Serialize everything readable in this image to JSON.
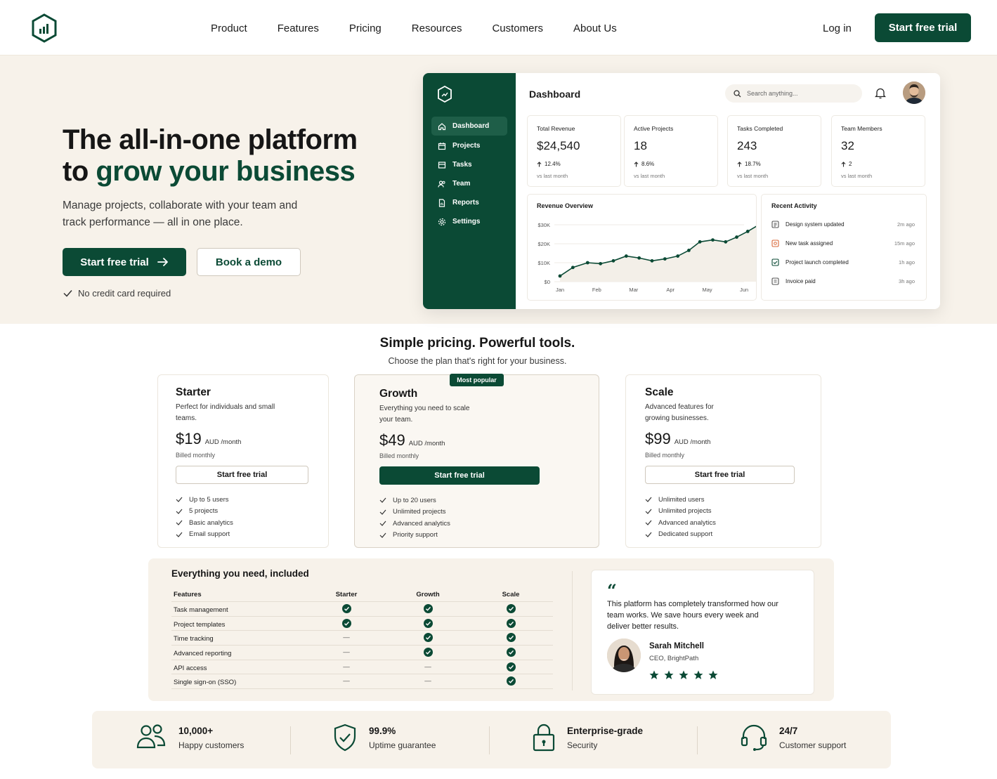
{
  "nav": {
    "links": [
      "Product",
      "Features",
      "Pricing",
      "Resources",
      "Customers",
      "About Us"
    ],
    "login": "Log in",
    "cta": "Start free trial"
  },
  "hero": {
    "title_line1": "The all-in-one platform",
    "title_line2_prefix": "to ",
    "title_line2_accent": "grow your business",
    "subtitle": "Manage projects, collaborate with your team and track performance — all in one place.",
    "primary_cta": "Start free trial",
    "secondary_cta": "Book a demo",
    "note": "No credit card required"
  },
  "dashboard": {
    "title": "Dashboard",
    "search_placeholder": "Search anything...",
    "sidebar": [
      "Dashboard",
      "Projects",
      "Tasks",
      "Team",
      "Reports",
      "Settings"
    ],
    "stats": [
      {
        "label": "Total Revenue",
        "value": "$24,540",
        "change": "12.4%",
        "sub": "vs last month"
      },
      {
        "label": "Active Projects",
        "value": "18",
        "change": "8.6%",
        "sub": "vs last month"
      },
      {
        "label": "Tasks Completed",
        "value": "243",
        "change": "18.7%",
        "sub": "vs last month"
      },
      {
        "label": "Team Members",
        "value": "32",
        "change": "2",
        "sub": "vs last month"
      }
    ],
    "revenue_title": "Revenue Overview",
    "activity_title": "Recent Activity",
    "activity": [
      {
        "text": "Design system updated",
        "time": "2m ago",
        "icon": "document-icon"
      },
      {
        "text": "New task assigned",
        "time": "15m ago",
        "icon": "task-icon"
      },
      {
        "text": "Project launch completed",
        "time": "1h ago",
        "icon": "check-square-icon"
      },
      {
        "text": "Invoice paid",
        "time": "3h ago",
        "icon": "invoice-icon"
      }
    ]
  },
  "chart_data": {
    "type": "line",
    "title": "Revenue Overview",
    "xlabel": "",
    "ylabel": "",
    "categories": [
      "Jan",
      "Feb",
      "Mar",
      "Apr",
      "May",
      "Jun"
    ],
    "y_ticks": [
      "$0",
      "$10K",
      "$20K",
      "$30K"
    ],
    "ylim": [
      0,
      30000
    ],
    "x": [
      0,
      0.35,
      0.75,
      1.1,
      1.45,
      1.8,
      2.15,
      2.5,
      2.85,
      3.2,
      3.5,
      3.8,
      4.15,
      4.5,
      4.8,
      5.1,
      5.4
    ],
    "values": [
      3000,
      7500,
      10000,
      9500,
      11000,
      13500,
      12500,
      11000,
      12000,
      13500,
      16500,
      21000,
      22000,
      21000,
      23500,
      26500,
      30000
    ],
    "grid": true,
    "accent_color": "#0b4a35"
  },
  "pricing": {
    "title": "Simple pricing. Powerful tools.",
    "subtitle": "Choose the plan that's right for your business.",
    "badge": "Most popular",
    "plans": [
      {
        "name": "Starter",
        "desc": "Perfect for individuals and small teams.",
        "price": "$19",
        "per": "AUD /month",
        "billed": "Billed monthly",
        "cta": "Start free trial",
        "features": [
          "Up to 5 users",
          "5 projects",
          "Basic analytics",
          "Email support"
        ]
      },
      {
        "name": "Growth",
        "desc": "Everything you need to scale your team.",
        "price": "$49",
        "per": "AUD /month",
        "billed": "Billed monthly",
        "cta": "Start free trial",
        "features": [
          "Up to 20 users",
          "Unlimited projects",
          "Advanced analytics",
          "Priority support"
        ]
      },
      {
        "name": "Scale",
        "desc": "Advanced features for growing businesses.",
        "price": "$99",
        "per": "AUD /month",
        "billed": "Billed monthly",
        "cta": "Start free trial",
        "features": [
          "Unlimited users",
          "Unlimited projects",
          "Advanced analytics",
          "Dedicated support"
        ]
      }
    ]
  },
  "comparison": {
    "title": "Everything you need, included",
    "headers": [
      "Features",
      "Starter",
      "Growth",
      "Scale"
    ],
    "rows": [
      {
        "feature": "Task management",
        "cells": [
          true,
          true,
          true
        ]
      },
      {
        "feature": "Project templates",
        "cells": [
          true,
          true,
          true
        ]
      },
      {
        "feature": "Time tracking",
        "cells": [
          false,
          true,
          true
        ]
      },
      {
        "feature": "Advanced reporting",
        "cells": [
          false,
          true,
          true
        ]
      },
      {
        "feature": "API access",
        "cells": [
          false,
          false,
          true
        ]
      },
      {
        "feature": "Single sign-on (SSO)",
        "cells": [
          false,
          false,
          true
        ]
      }
    ],
    "dash_char": "—"
  },
  "testimonial": {
    "quote_mark": "“",
    "text": "This platform has completely transformed how our team works. We save hours every week and deliver better results.",
    "name": "Sarah Mitchell",
    "role": "CEO, BrightPath",
    "rating": 5
  },
  "stats_bar": [
    {
      "title": "10,000+",
      "sub": "Happy customers",
      "icon": "users-icon"
    },
    {
      "title": "99.9%",
      "sub": "Uptime guarantee",
      "icon": "shield-check-icon"
    },
    {
      "title": "Enterprise-grade",
      "sub": "Security",
      "icon": "lock-icon"
    },
    {
      "title": "24/7",
      "sub": "Customer support",
      "icon": "headset-icon"
    }
  ],
  "colors": {
    "brand": "#0b4a35",
    "cream": "#f7f2ea"
  }
}
